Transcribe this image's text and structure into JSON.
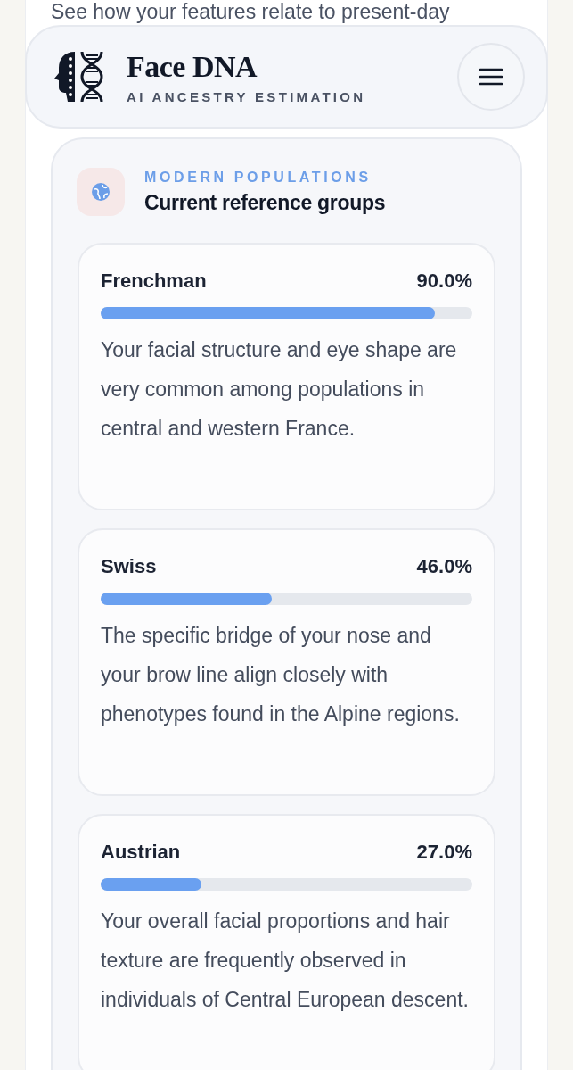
{
  "intro_text": "See how your features relate to present-day",
  "header": {
    "title": "Face DNA",
    "subtitle": "AI ANCESTRY ESTIMATION"
  },
  "section": {
    "eyebrow": "MODERN POPULATIONS",
    "title": "Current reference groups"
  },
  "populations": [
    {
      "name": "Frenchman",
      "percent": "90.0%",
      "level": 0.9,
      "description": "Your facial structure and eye shape are very common among populations in central and western France."
    },
    {
      "name": "Swiss",
      "percent": "46.0%",
      "level": 0.46,
      "description": "The specific bridge of your nose and your brow line align closely with phenotypes found in the Alpine regions."
    },
    {
      "name": "Austrian",
      "percent": "27.0%",
      "level": 0.27,
      "description": "Your overall facial proportions and hair texture are frequently observed in individuals of Central European descent."
    }
  ]
}
